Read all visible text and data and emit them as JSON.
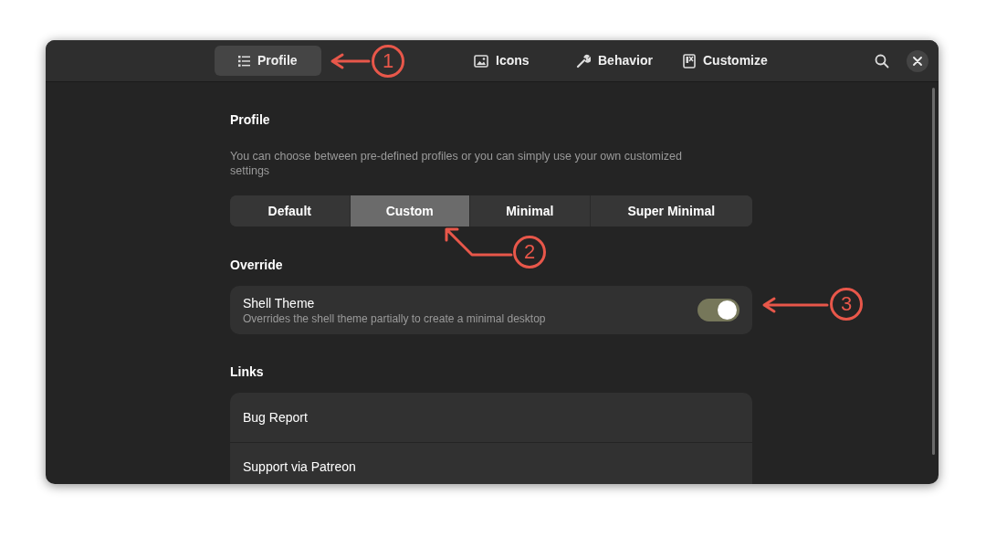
{
  "tabs": [
    {
      "label": "Profile",
      "selected": true
    },
    {
      "label": "Icons",
      "selected": false
    },
    {
      "label": "Behavior",
      "selected": false
    },
    {
      "label": "Customize",
      "selected": false
    }
  ],
  "profile": {
    "title": "Profile",
    "description": "You can choose between pre-defined profiles or you can simply use your own customized settings",
    "options": [
      {
        "label": "Default",
        "selected": false
      },
      {
        "label": "Custom",
        "selected": true
      },
      {
        "label": "Minimal",
        "selected": false
      },
      {
        "label": "Super Minimal",
        "selected": false
      }
    ]
  },
  "override": {
    "title": "Override",
    "items": [
      {
        "title": "Shell Theme",
        "subtitle": "Overrides the shell theme partially to create a minimal desktop",
        "on": true
      }
    ]
  },
  "links": {
    "title": "Links",
    "items": [
      "Bug Report",
      "Support via Patreon"
    ]
  },
  "annotations": [
    "1",
    "2",
    "3"
  ]
}
